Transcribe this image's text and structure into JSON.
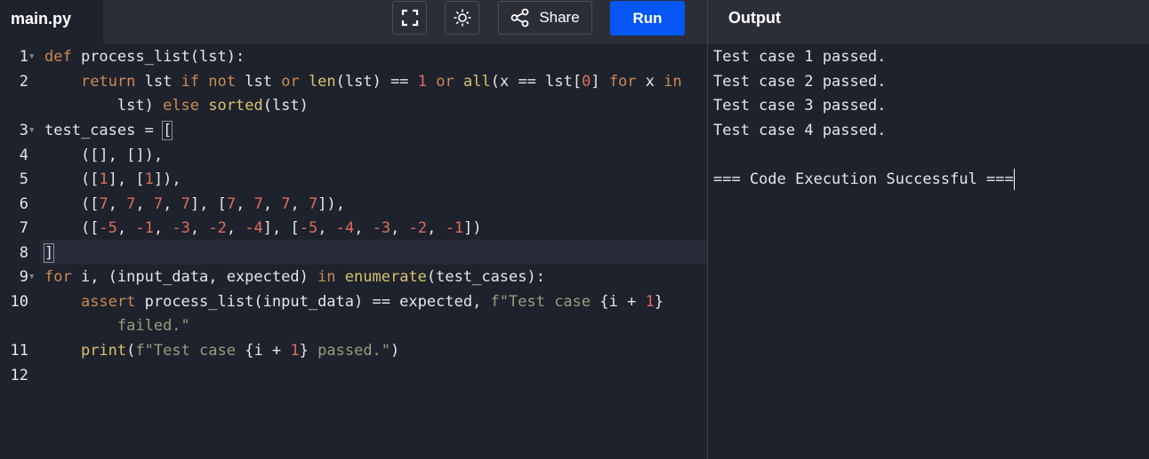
{
  "file_tab": "main.py",
  "toolbar": {
    "share_label": "Share",
    "run_label": "Run"
  },
  "output_panel": {
    "title": "Output",
    "lines": [
      "Test case 1 passed.",
      "Test case 2 passed.",
      "Test case 3 passed.",
      "Test case 4 passed.",
      "",
      "=== Code Execution Successful ==="
    ]
  },
  "editor": {
    "line_numbers": [
      "1",
      "2",
      "3",
      "4",
      "5",
      "6",
      "7",
      "8",
      "9",
      "10",
      "11",
      "12"
    ],
    "code": {
      "l1_def": "def",
      "l1_rest": " process_list(lst):",
      "l2_indent": "    ",
      "l2_return": "return",
      "l2_a": " lst ",
      "l2_if": "if",
      "l2_sp1": " ",
      "l2_not": "not",
      "l2_b": " lst ",
      "l2_or1": "or",
      "l2_sp2": " ",
      "l2_len": "len",
      "l2_c": "(lst) == ",
      "l2_one": "1",
      "l2_sp3": " ",
      "l2_or2": "or",
      "l2_sp4": " ",
      "l2_all": "all",
      "l2_d": "(x == lst[",
      "l2_zero": "0",
      "l2_e": "] ",
      "l2_for": "for",
      "l2_f": " x ",
      "l2_in": "in",
      "l2w_indent": "        ",
      "l2w_a": "lst) ",
      "l2w_else": "else",
      "l2w_sp": " ",
      "l2w_sorted": "sorted",
      "l2w_b": "(lst)",
      "l3_a": "test_cases = ",
      "l3_br": "[",
      "l4": "    ([], []),",
      "l5_a": "    ([",
      "l5_n1": "1",
      "l5_b": "], [",
      "l5_n2": "1",
      "l5_c": "]),",
      "l6_a": "    ([",
      "l6_b": "], [",
      "l6_c": "]),",
      "l6_vals1": [
        "7",
        "7",
        "7",
        "7"
      ],
      "l6_vals2": [
        "7",
        "7",
        "7",
        "7"
      ],
      "l7_a": "    ([",
      "l7_b": "], [",
      "l7_c": "])",
      "l7_vals1": [
        "-5",
        "-1",
        "-3",
        "-2",
        "-4"
      ],
      "l7_vals2": [
        "-5",
        "-4",
        "-3",
        "-2",
        "-1"
      ],
      "sep": ", ",
      "l8_br": "]",
      "l9_for": "for",
      "l9_a": " i, (input_data, expected) ",
      "l9_in": "in",
      "l9_sp": " ",
      "l9_enum": "enumerate",
      "l9_b": "(test_cases):",
      "l10_indent": "    ",
      "l10_assert": "assert",
      "l10_a": " process_list(input_data) == expected, ",
      "l10_str1": "f\"Test case ",
      "l10_b": "{i + ",
      "l10_one": "1",
      "l10_c": "}",
      "l10w_indent": "        ",
      "l10w_str": "failed.\"",
      "l11_indent": "    ",
      "l11_print": "print",
      "l11_a": "(",
      "l11_str1": "f\"Test case ",
      "l11_b": "{i + ",
      "l11_one": "1",
      "l11_c": "}",
      "l11_str2": " passed.\"",
      "l11_d": ")"
    }
  }
}
